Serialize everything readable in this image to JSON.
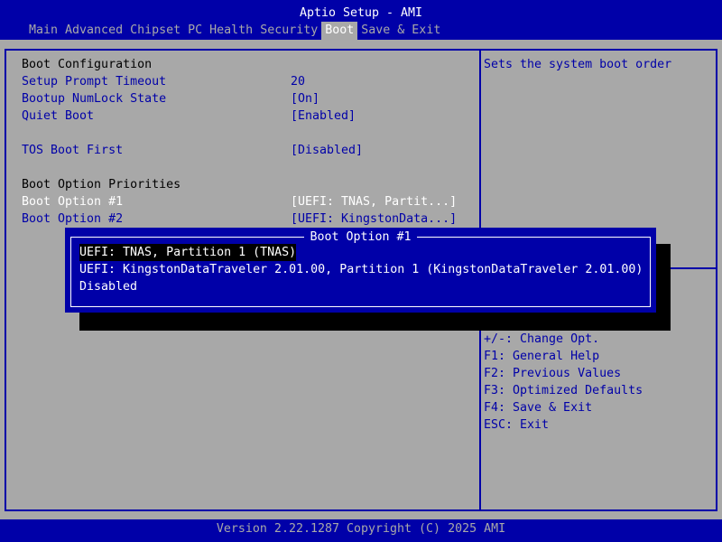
{
  "header": {
    "title": "Aptio Setup - AMI",
    "tabs": [
      "Main",
      "Advanced",
      "Chipset",
      "PC Health",
      "Security",
      "Boot",
      "Save & Exit"
    ],
    "active_tab": "Boot"
  },
  "settings": {
    "boot_configuration": "Boot Configuration",
    "setup_prompt_timeout": {
      "label": "Setup Prompt Timeout",
      "value": "20"
    },
    "bootup_numlock": {
      "label": "Bootup NumLock State",
      "value": "[On]"
    },
    "quiet_boot": {
      "label": "Quiet Boot",
      "value": "[Enabled]"
    },
    "tos_boot_first": {
      "label": "TOS Boot First",
      "value": "[Disabled]"
    },
    "boot_option_priorities": "Boot Option Priorities",
    "boot_option_1": {
      "label": "Boot Option #1",
      "value": "[UEFI: TNAS, Partit...]"
    },
    "boot_option_2": {
      "label": "Boot Option #2",
      "value": "[UEFI: KingstonData...]"
    }
  },
  "help": {
    "description": "Sets the system boot order",
    "keys": [
      "+/-: Change Opt.",
      "F1: General Help",
      "F2: Previous Values",
      "F3: Optimized Defaults",
      "F4: Save & Exit",
      "ESC: Exit"
    ]
  },
  "popup": {
    "title": "Boot Option #1",
    "options": [
      "UEFI: TNAS, Partition 1 (TNAS)",
      "UEFI: KingstonDataTraveler 2.01.00, Partition 1 (KingstonDataTraveler 2.01.00)",
      "Disabled"
    ],
    "selected": 0
  },
  "footer": "Version 2.22.1287 Copyright (C) 2025 AMI"
}
